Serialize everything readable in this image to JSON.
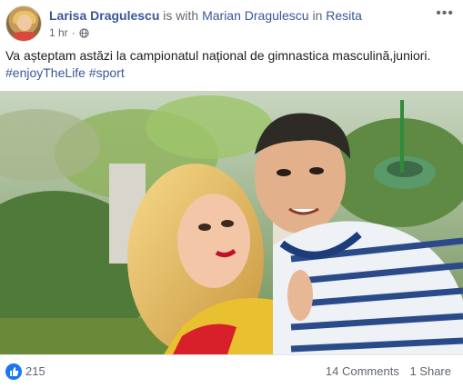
{
  "header": {
    "author": "Larisa Dragulescu",
    "with_text": "is with",
    "tagged": "Marian Dragulescu",
    "location_prefix": "in",
    "location": "Resita",
    "timestamp": "1 hr",
    "privacy_icon": "globe-icon",
    "more_icon": "more-options-icon",
    "more_glyph": "•••"
  },
  "post": {
    "text": "Va așteptam astăzi la campionatul național de gimnastica masculină,juniori.",
    "hashtags": "#enjoyTheLife #sport"
  },
  "footer": {
    "like_icon": "like-thumb-icon",
    "reactions_count": "215",
    "comments": "14 Comments",
    "shares": "1 Share"
  },
  "colors": {
    "link": "#385898",
    "secondary": "#606770",
    "like_blue": "#1877f2"
  }
}
